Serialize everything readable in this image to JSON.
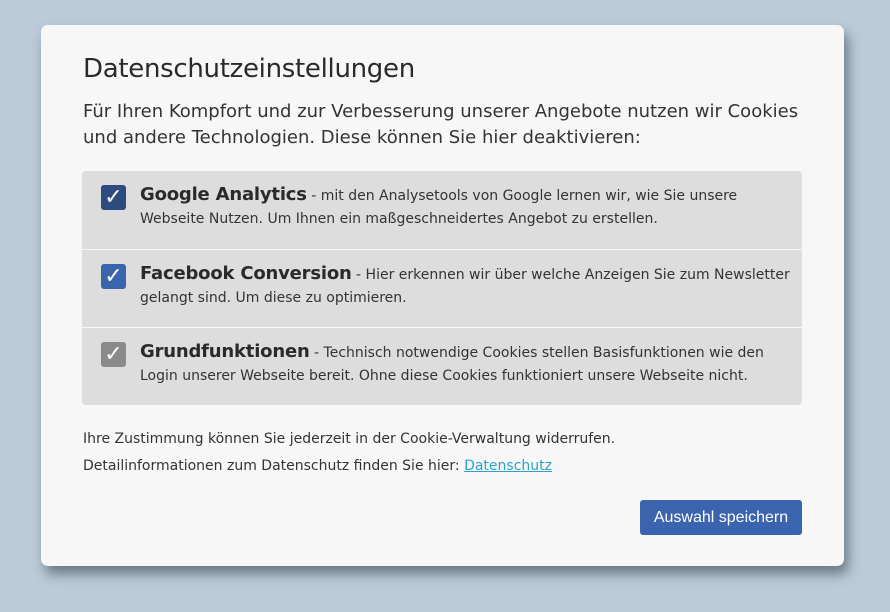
{
  "dialog": {
    "title": "Datenschutzeinstellungen",
    "intro": "Für Ihren Kompfort und zur Verbesserung unserer Angebote nutzen wir Cookies und andere Technologien. Diese können Sie hier deaktivieren:"
  },
  "options": [
    {
      "name": "Google Analytics",
      "description": " - mit den Analysetools von Google lernen wir, wie Sie unsere Webseite Nutzen. Um Ihnen ein maßgeschneidertes Angebot zu erstellen.",
      "checked": true,
      "check_glyph": "✓",
      "color": "#2d4b7e"
    },
    {
      "name": "Facebook Conversion",
      "description": " - Hier erkennen wir über welche Anzeigen Sie zum Newsletter gelangt sind. Um diese zu optimieren.",
      "checked": true,
      "check_glyph": "✓",
      "color": "#3a64ad"
    },
    {
      "name": "Grundfunktionen",
      "description": " - Technisch notwendige Cookies stellen Basisfunktionen wie den Login unserer Webseite bereit. Ohne diese Cookies funktioniert unsere Webseite nicht.",
      "checked": true,
      "check_glyph": "✓",
      "color": "#8a8a8a"
    }
  ],
  "footer": {
    "revoke_text": "Ihre Zustimmung können Sie jederzeit in der Cookie-Verwaltung widerrufen.",
    "details_text": "Detailinformationen zum Datenschutz finden Sie hier: ",
    "privacy_link": "Datenschutz"
  },
  "actions": {
    "save_label": "Auswahl speichern"
  },
  "colors": {
    "accent": "#3a64ad",
    "link": "#2aa3c7",
    "background": "#bccbd8"
  }
}
